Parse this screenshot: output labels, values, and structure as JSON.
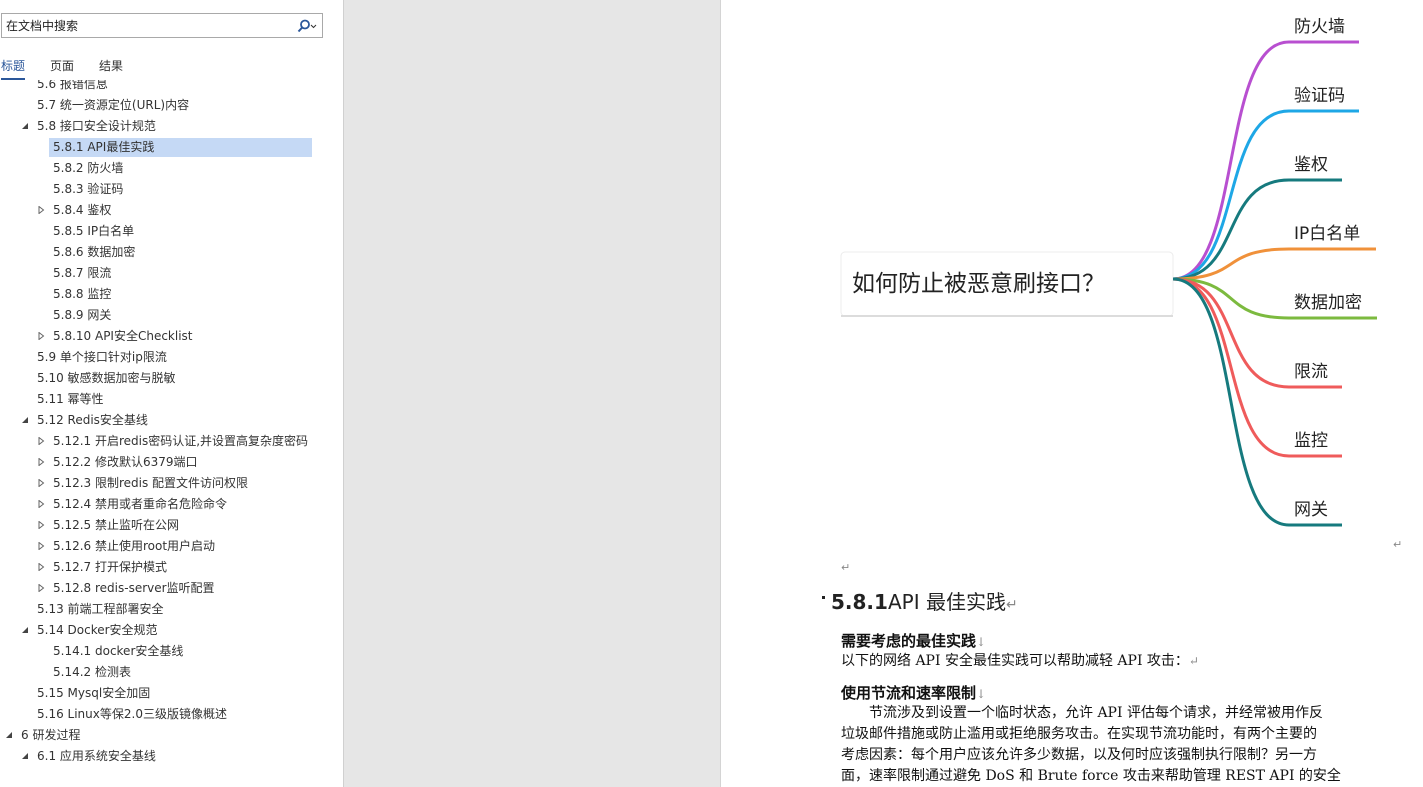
{
  "nav": {
    "search": {
      "placeholder": "在文档中搜索"
    },
    "tabs": [
      "标题",
      "页面",
      "结果"
    ],
    "outline": [
      {
        "text": "5.6 报错信息",
        "level": 1,
        "toggle": "none",
        "selected": false
      },
      {
        "text": "5.7 统一资源定位(URL)内容",
        "level": 1,
        "toggle": "none",
        "selected": false
      },
      {
        "text": "5.8 接口安全设计规范",
        "level": 1,
        "toggle": "expanded",
        "selected": false
      },
      {
        "text": "5.8.1  API最佳实践",
        "level": 2,
        "toggle": "none",
        "selected": true
      },
      {
        "text": "5.8.2  防火墙",
        "level": 2,
        "toggle": "none",
        "selected": false
      },
      {
        "text": "5.8.3  验证码",
        "level": 2,
        "toggle": "none",
        "selected": false
      },
      {
        "text": "5.8.4  鉴权",
        "level": 2,
        "toggle": "collapsed",
        "selected": false
      },
      {
        "text": "5.8.5  IP白名单",
        "level": 2,
        "toggle": "none",
        "selected": false
      },
      {
        "text": "5.8.6  数据加密",
        "level": 2,
        "toggle": "none",
        "selected": false
      },
      {
        "text": "5.8.7  限流",
        "level": 2,
        "toggle": "none",
        "selected": false
      },
      {
        "text": "5.8.8  监控",
        "level": 2,
        "toggle": "none",
        "selected": false
      },
      {
        "text": "5.8.9  网关",
        "level": 2,
        "toggle": "none",
        "selected": false
      },
      {
        "text": "5.8.10  API安全Checklist",
        "level": 2,
        "toggle": "collapsed",
        "selected": false
      },
      {
        "text": "5.9 单个接口针对ip限流",
        "level": 1,
        "toggle": "none",
        "selected": false
      },
      {
        "text": "5.10 敏感数据加密与脱敏",
        "level": 1,
        "toggle": "none",
        "selected": false
      },
      {
        "text": "5.11 幂等性",
        "level": 1,
        "toggle": "none",
        "selected": false
      },
      {
        "text": "5.12 Redis安全基线",
        "level": 1,
        "toggle": "expanded",
        "selected": false
      },
      {
        "text": "5.12.1 开启redis密码认证,并设置高复杂度密码",
        "level": 2,
        "toggle": "collapsed",
        "selected": false
      },
      {
        "text": "5.12.2 修改默认6379端口",
        "level": 2,
        "toggle": "collapsed",
        "selected": false
      },
      {
        "text": "5.12.3 限制redis 配置文件访问权限",
        "level": 2,
        "toggle": "collapsed",
        "selected": false
      },
      {
        "text": "5.12.4 禁用或者重命名危险命令",
        "level": 2,
        "toggle": "collapsed",
        "selected": false
      },
      {
        "text": "5.12.5 禁止监听在公网",
        "level": 2,
        "toggle": "collapsed",
        "selected": false
      },
      {
        "text": "5.12.6 禁止使用root用户启动",
        "level": 2,
        "toggle": "collapsed",
        "selected": false
      },
      {
        "text": "5.12.7 打开保护模式",
        "level": 2,
        "toggle": "collapsed",
        "selected": false
      },
      {
        "text": "5.12.8 redis-server监听配置",
        "level": 2,
        "toggle": "collapsed",
        "selected": false
      },
      {
        "text": "5.13 前端工程部署安全",
        "level": 1,
        "toggle": "none",
        "selected": false
      },
      {
        "text": "5.14 Docker安全规范",
        "level": 1,
        "toggle": "expanded",
        "selected": false
      },
      {
        "text": "5.14.1 docker安全基线",
        "level": 2,
        "toggle": "none",
        "selected": false
      },
      {
        "text": "5.14.2 检测表",
        "level": 2,
        "toggle": "none",
        "selected": false
      },
      {
        "text": "5.15 Mysql安全加固",
        "level": 1,
        "toggle": "none",
        "selected": false
      },
      {
        "text": "5.16 Linux等保2.0三级版镜像概述",
        "level": 1,
        "toggle": "none",
        "selected": false
      },
      {
        "text": "6 研发过程",
        "level": 0,
        "toggle": "expanded",
        "selected": false
      },
      {
        "text": "6.1 应用系统安全基线",
        "level": 1,
        "toggle": "expanded",
        "selected": false
      }
    ]
  },
  "mindmap": {
    "root": "如何防止被恶意刷接口？",
    "branches": [
      {
        "label": "防火墙",
        "color": "#b84fd0"
      },
      {
        "label": "验证码",
        "color": "#1ea7e6"
      },
      {
        "label": "鉴权",
        "color": "#167a7e"
      },
      {
        "label": "IP白名单",
        "color": "#f0913a"
      },
      {
        "label": "数据加密",
        "color": "#7cba3f"
      },
      {
        "label": "限流",
        "color": "#ef5b5b"
      },
      {
        "label": "监控",
        "color": "#ef5b5b"
      },
      {
        "label": "网关",
        "color": "#167a7e"
      }
    ]
  },
  "document": {
    "heading_number": "5.8.1",
    "heading_title": "API 最佳实践",
    "section1_title": "需要考虑的最佳实践",
    "section1_text": "以下的网络 API 安全最佳实践可以帮助减轻 API 攻击：",
    "section2_title": "使用节流和速率限制",
    "para_lines": [
      "　　节流涉及到设置一个临时状态，允许 API 评估每个请求，并经常被用作反",
      "垃圾邮件措施或防止滥用或拒绝服务攻击。在实现节流功能时，有两个主要的",
      "考虑因素：每个用户应该允许多少数据，以及何时应该强制执行限制？另一方",
      "面，速率限制通过避免 DoS 和 Brute force 攻击来帮助管理 REST API 的安全"
    ]
  }
}
